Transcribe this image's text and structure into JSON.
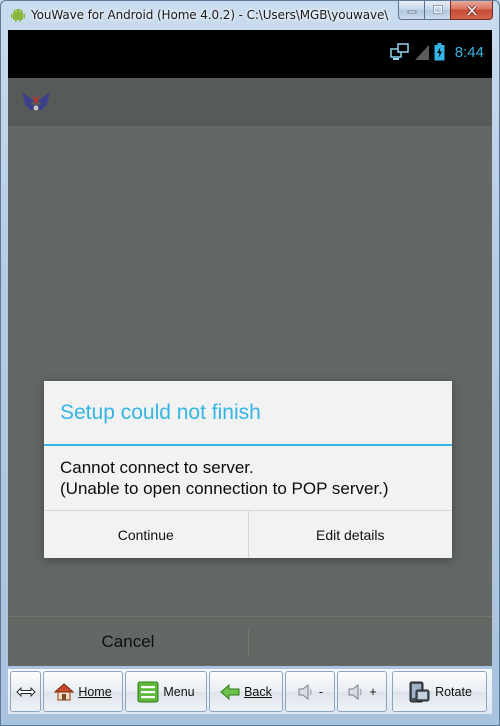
{
  "window": {
    "title": "YouWave for Android (Home 4.0.2) - C:\\Users\\MGB\\youwave\\"
  },
  "statusbar": {
    "time": "8:44",
    "icons": [
      "network-sync-icon",
      "signal-icon",
      "battery-charging-icon"
    ]
  },
  "actionbar": {
    "app_icon": "email-app-icon"
  },
  "dialog": {
    "title": "Setup could not finish",
    "message_line1": "Cannot connect to server.",
    "message_line2": "(Unable to open connection to POP server.)",
    "continue_label": "Continue",
    "edit_details_label": "Edit details"
  },
  "screen": {
    "cancel_label": "Cancel"
  },
  "toolbar": {
    "home_label": "Home",
    "menu_label": "Menu",
    "back_label": "Back",
    "volume_down_label": "-",
    "volume_up_label": "+",
    "rotate_label": "Rotate"
  },
  "colors": {
    "accent": "#33b5e5",
    "dim_background": "#636865",
    "dialog_background": "#f2f2f2"
  }
}
